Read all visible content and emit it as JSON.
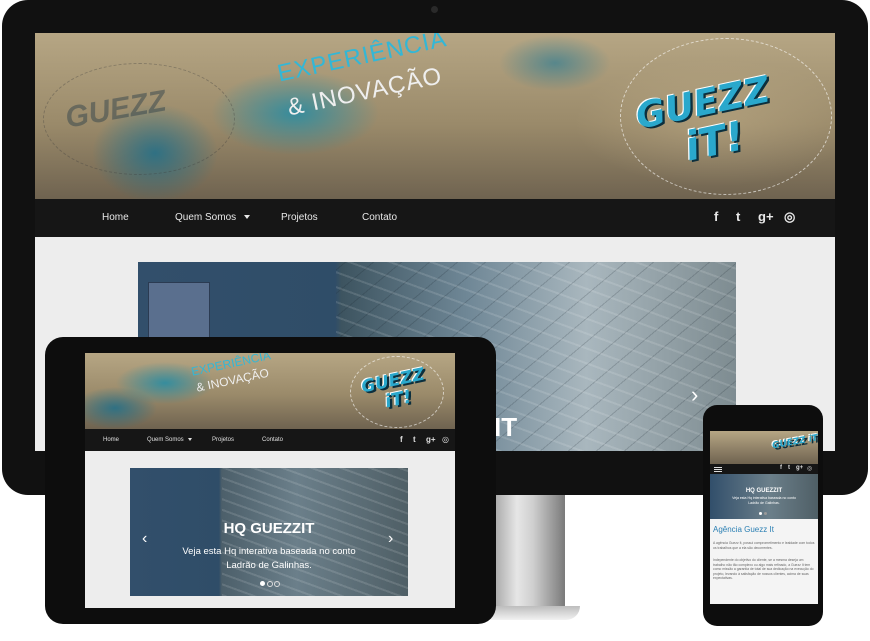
{
  "desktop": {
    "tagline": {
      "line1": "EXPERIÊNCIA",
      "line2": "& INOVAÇÃO"
    },
    "logo": {
      "line1": "GUEZZ",
      "line2": "iT!"
    },
    "nav": {
      "home": "Home",
      "about": "Quem Somos",
      "projects": "Projetos",
      "contact": "Contato"
    },
    "social_icons": [
      "facebook-icon",
      "twitter-icon",
      "google-plus-icon",
      "dribbble-icon"
    ],
    "social_glyphs": {
      "facebook": "f",
      "twitter": "t",
      "google": "g+",
      "dribbble": "◎"
    },
    "slider": {
      "caption_fragment": "IT"
    }
  },
  "tablet": {
    "tagline": {
      "line1": "EXPERIÊNCIA",
      "line2": "& INOVAÇÃO"
    },
    "logo": {
      "line1": "GUEZZ",
      "line2": "iT!"
    },
    "nav": {
      "home": "Home",
      "about": "Quem Somos",
      "projects": "Projetos",
      "contact": "Contato"
    },
    "slider": {
      "title": "HQ GUEZZIT",
      "caption_line1": "Veja esta Hq interativa baseada no conto",
      "caption_line2": "Ladrão de Galinhas."
    }
  },
  "phone": {
    "logo": "GUEZZ iT!",
    "slider": {
      "title": "HQ GUEZZIT",
      "caption_line1": "Veja esta Hq interativa baseada no conto",
      "caption_line2": "Ladrão de Galinhas."
    },
    "heading": "Agência Guezz It",
    "para1": "A agência Guezz It, possui comprometimento e lealdade com todos os trabalhos que a ela são decorrentes.",
    "para2": "Independente do objetivo do cliente, se a mesma deseja um trabalho não tão complexo ou algo mais refinado, a Guezz It tem como missão a garantia de total de sua dedicação na execução do projeto, levando à satisfação de nossos clientes, acima de suas expectativas."
  },
  "colors": {
    "accent": "#2aa8cc",
    "nav_bg": "#161616",
    "bezel": "#111111"
  }
}
